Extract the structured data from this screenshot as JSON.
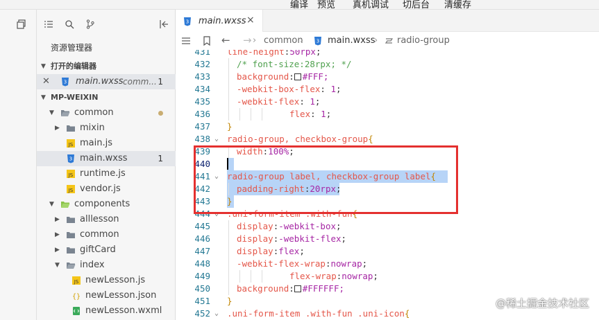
{
  "top_menu": [
    "编译",
    "预览",
    "真机调试",
    "切后台",
    "清缓存"
  ],
  "sidebar": {
    "title": "资源管理器",
    "open_editors": {
      "label": "打开的编辑器",
      "item": {
        "name": "main.wxss",
        "path": "comm...",
        "badge": "1"
      }
    },
    "project": {
      "label": "MP-WEIXIN"
    },
    "tree": [
      {
        "name": "common",
        "type": "folder",
        "state": "expanded",
        "modified_dot": true
      },
      {
        "name": "mixin",
        "type": "folder",
        "state": "collapsed"
      },
      {
        "name": "main.js",
        "type": "js"
      },
      {
        "name": "main.wxss",
        "type": "wxss",
        "badge": "1",
        "selected": true
      },
      {
        "name": "runtime.js",
        "type": "js"
      },
      {
        "name": "vendor.js",
        "type": "js"
      },
      {
        "name": "components",
        "type": "folder",
        "state": "expanded"
      },
      {
        "name": "alllesson",
        "type": "folder",
        "state": "collapsed"
      },
      {
        "name": "common",
        "type": "folder",
        "state": "collapsed"
      },
      {
        "name": "giftCard",
        "type": "folder",
        "state": "collapsed"
      },
      {
        "name": "index",
        "type": "folder",
        "state": "expanded"
      },
      {
        "name": "newLesson.js",
        "type": "js"
      },
      {
        "name": "newLesson.json",
        "type": "json"
      },
      {
        "name": "newLesson.wxml",
        "type": "wxml"
      }
    ]
  },
  "editor": {
    "tab": {
      "name": "main.wxss",
      "close": "×"
    },
    "breadcrumb": [
      "common",
      "main.wxss",
      "radio-group"
    ],
    "lines": [
      {
        "n": "431",
        "text": "line-height:50rpx;"
      },
      {
        "n": "432",
        "text": "/* font-size:28rpx; */"
      },
      {
        "n": "433",
        "text": "background:",
        "swatch": true,
        "val": "#FFF;"
      },
      {
        "n": "434",
        "text": "-webkit-box-flex: 1;"
      },
      {
        "n": "435",
        "text": "-webkit-flex: 1;"
      },
      {
        "n": "436",
        "text": "flex: 1;"
      },
      {
        "n": "437",
        "text": "}"
      },
      {
        "n": "438",
        "text": "radio-group, checkbox-group{"
      },
      {
        "n": "439",
        "text": "width:100%;"
      },
      {
        "n": "440",
        "text": ""
      },
      {
        "n": "441",
        "text": "radio-group label, checkbox-group label{"
      },
      {
        "n": "442",
        "text": "padding-right:20rpx;"
      },
      {
        "n": "443",
        "text": "}"
      },
      {
        "n": "444",
        "text": ".uni-form-item .with-fun{"
      },
      {
        "n": "445",
        "text": "display:-webkit-box;"
      },
      {
        "n": "446",
        "text": "display:-webkit-flex;"
      },
      {
        "n": "447",
        "text": "display:flex;"
      },
      {
        "n": "448",
        "text": "-webkit-flex-wrap:nowrap;"
      },
      {
        "n": "449",
        "text": "flex-wrap:nowrap;"
      },
      {
        "n": "450",
        "text": "background:",
        "swatch": true,
        "val": "#FFFFFF;"
      },
      {
        "n": "451",
        "text": "}"
      },
      {
        "n": "452",
        "text": ".uni-form-item .with-fun .uni-icon{"
      }
    ]
  },
  "watermark": "@稀土掘金技术社区"
}
